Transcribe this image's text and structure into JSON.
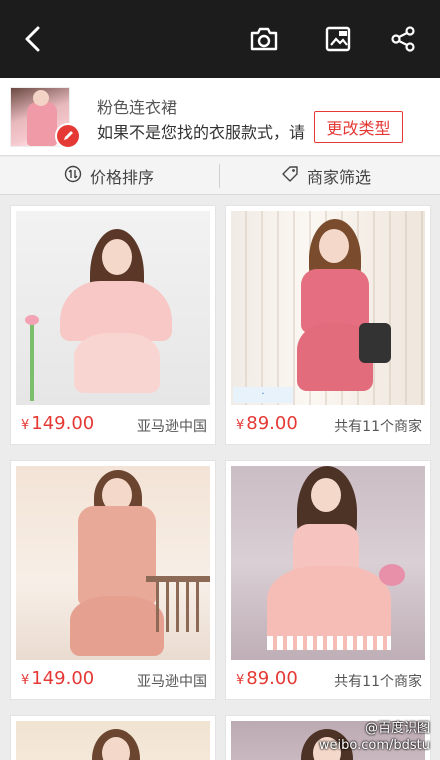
{
  "header": {
    "icons": [
      "back-arrow-icon",
      "camera-icon",
      "image-icon",
      "share-icon"
    ]
  },
  "query": {
    "title": "粉色连衣裙",
    "subtitle": "如果不是您找的衣服款式，请",
    "change_type_label": "更改类型"
  },
  "filters": {
    "price_sort_label": "价格排序",
    "merchant_filter_label": "商家筛选"
  },
  "products": [
    {
      "currency": "¥",
      "price": "149.00",
      "seller": "亚马逊中国"
    },
    {
      "currency": "¥",
      "price": "89.00",
      "seller": "共有11个商家"
    },
    {
      "currency": "¥",
      "price": "149.00",
      "seller": "亚马逊中国"
    },
    {
      "currency": "¥",
      "price": "89.00",
      "seller": "共有11个商家"
    }
  ],
  "watermark": {
    "line1": "@百度识图",
    "line2": "weibo.com/bdstu"
  },
  "colors": {
    "accent": "#e53935",
    "topbar": "#1c1c1c",
    "background": "#ececec"
  }
}
